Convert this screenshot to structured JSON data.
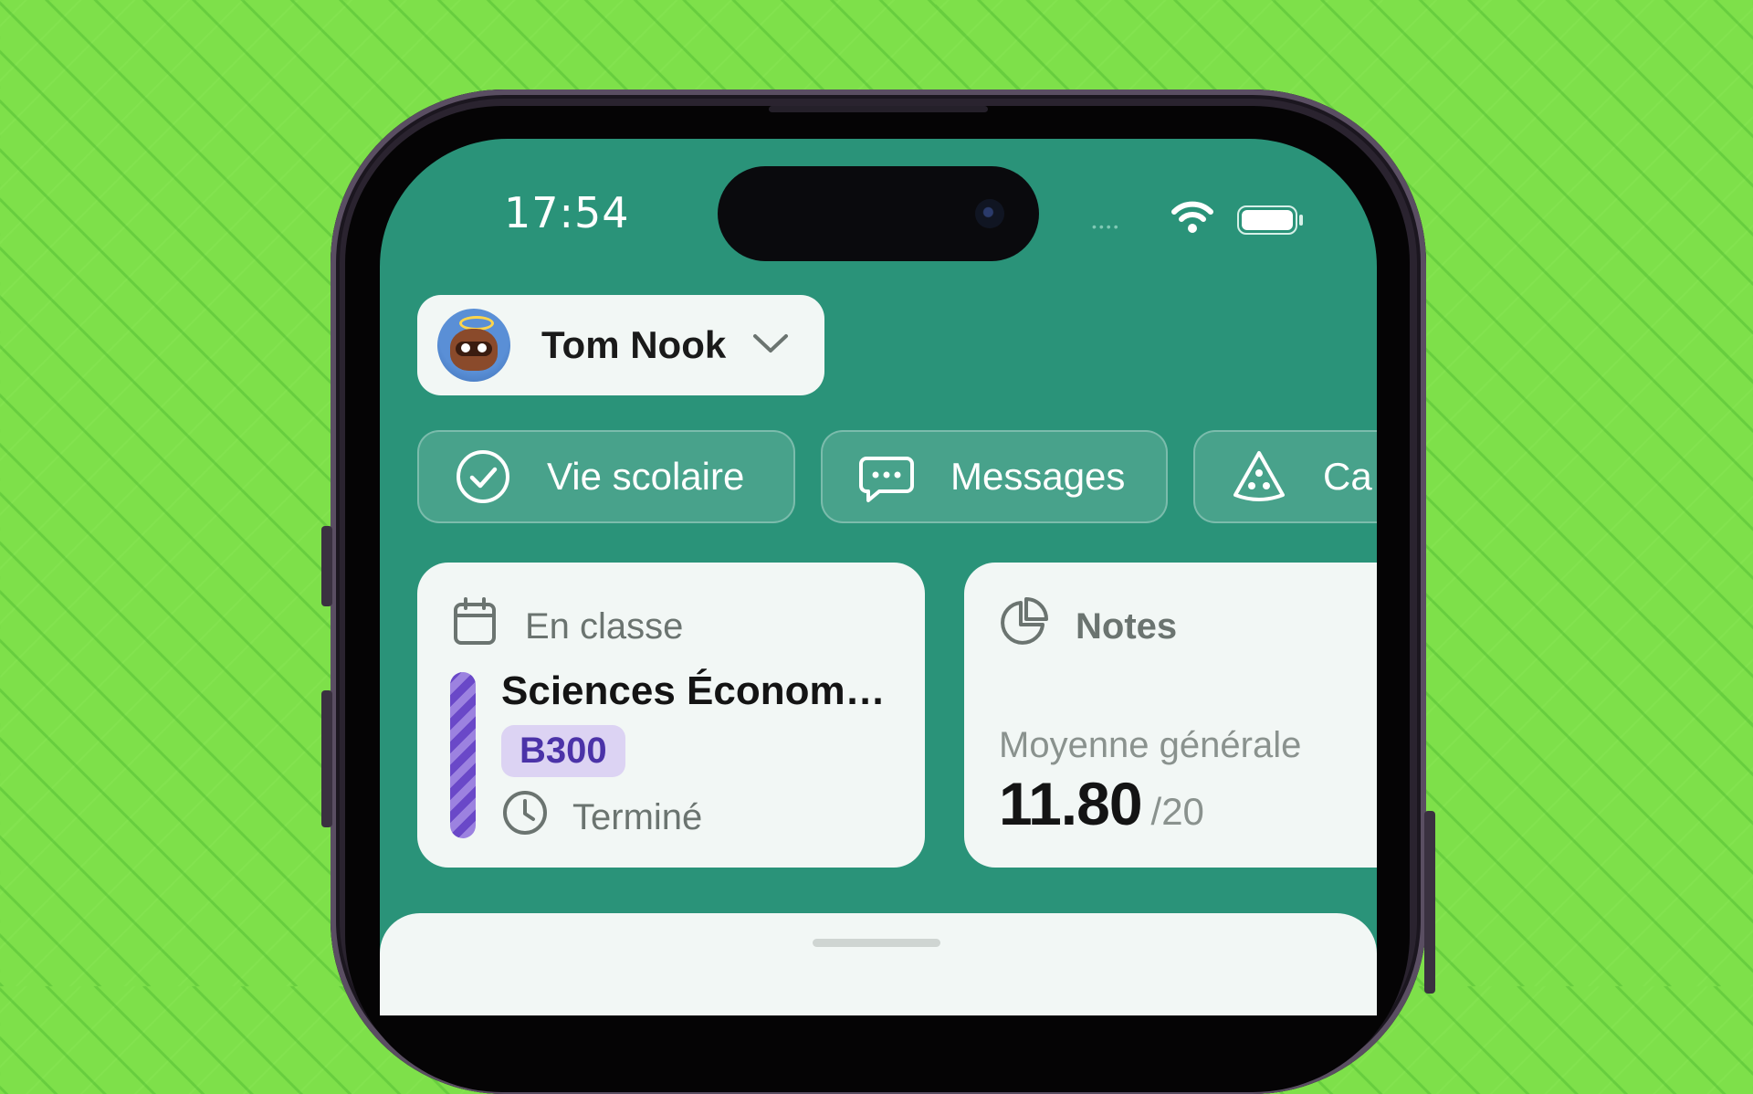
{
  "status_bar": {
    "time": "17:54",
    "signal_dots": "••••",
    "wifi_icon": "wifi-icon",
    "battery_icon": "battery-icon"
  },
  "profile": {
    "name": "Tom Nook",
    "avatar_icon": "raccoon-avatar",
    "chevron_icon": "chevron-down-icon"
  },
  "quick_actions": [
    {
      "label": "Vie scolaire",
      "icon": "check-circle-icon"
    },
    {
      "label": "Messages",
      "icon": "chat-bubble-icon"
    },
    {
      "label": "Ca",
      "icon": "pizza-slice-icon"
    }
  ],
  "class_card": {
    "header": "En classe",
    "header_icon": "calendar-icon",
    "subject": "Sciences Économ…",
    "room": "B300",
    "status": "Terminé",
    "status_icon": "clock-icon",
    "accent_color": "#6a48c8"
  },
  "grades_card": {
    "header": "Notes",
    "header_icon": "pie-chart-icon",
    "average_label": "Moyenne générale",
    "average_value": "11.80",
    "average_scale": "/20"
  },
  "colors": {
    "background": "#7ee04a",
    "screen": "#2a9379",
    "card": "#f2f7f5"
  }
}
